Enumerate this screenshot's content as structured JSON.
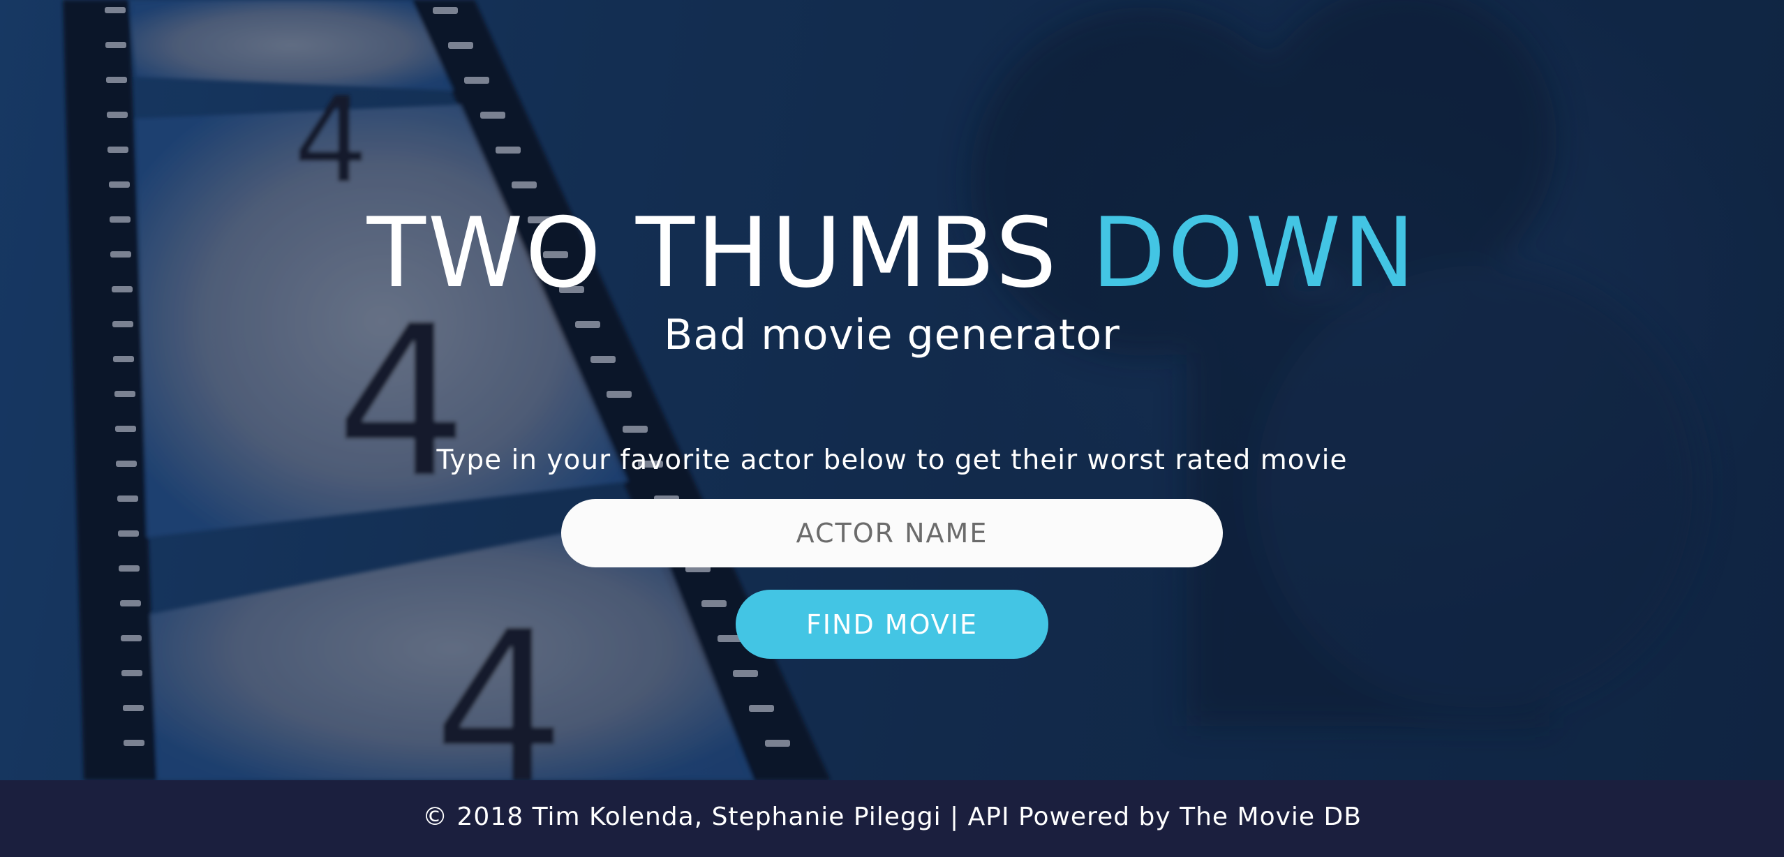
{
  "hero": {
    "title_main": "TWO THUMBS ",
    "title_accent": "DOWN",
    "subtitle": "Bad movie generator",
    "instructions": "Type in your favorite actor below to get their worst rated movie",
    "search": {
      "placeholder": "ACTOR NAME",
      "value": ""
    },
    "find_button_label": "FIND MOVIE"
  },
  "footer": {
    "text": "© 2018 Tim Kolenda, Stephanie Pileggi | API Powered by The Movie DB"
  },
  "colors": {
    "accent": "#43c5e4",
    "footer_bg": "#1b1f3e",
    "hero_bg": "#14263f",
    "input_bg": "#fbfbfb"
  },
  "icons": {
    "background": "film-strip-countdown-image"
  }
}
